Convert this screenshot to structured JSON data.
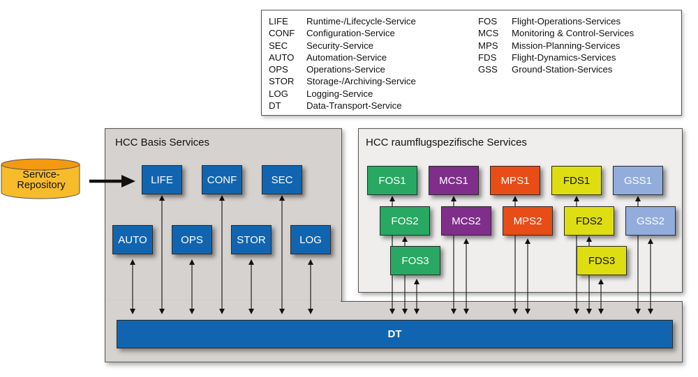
{
  "legend": {
    "left": [
      {
        "abbr": "LIFE",
        "name": "Runtime-/Lifecycle-Service"
      },
      {
        "abbr": "CONF",
        "name": "Configuration-Service"
      },
      {
        "abbr": "SEC",
        "name": "Security-Service"
      },
      {
        "abbr": "AUTO",
        "name": "Automation-Service"
      },
      {
        "abbr": "OPS",
        "name": "Operations-Service"
      },
      {
        "abbr": "STOR",
        "name": "Storage-/Archiving-Service"
      },
      {
        "abbr": "LOG",
        "name": "Logging-Service"
      },
      {
        "abbr": "DT",
        "name": "Data-Transport-Service"
      }
    ],
    "right": [
      {
        "abbr": "FOS",
        "name": "Flight-Operations-Services"
      },
      {
        "abbr": "MCS",
        "name": "Monitoring & Control-Services"
      },
      {
        "abbr": "MPS",
        "name": "Mission-Planning-Services"
      },
      {
        "abbr": "FDS",
        "name": "Flight-Dynamics-Services"
      },
      {
        "abbr": "GSS",
        "name": "Ground-Station-Services"
      }
    ]
  },
  "repository": {
    "label": "Service-\nRepository",
    "line1": "Service-",
    "line2": "Repository"
  },
  "basis_panel": {
    "title": "HCC Basis Services",
    "top_row": [
      "LIFE",
      "CONF",
      "SEC"
    ],
    "bottom_row": [
      "AUTO",
      "OPS",
      "STOR",
      "LOG"
    ],
    "bus": "DT"
  },
  "space_panel": {
    "title": "HCC raumflugspezifische Services",
    "groups": [
      {
        "family": "FOS",
        "color": "#28a862",
        "items": [
          "FOS1",
          "FOS2",
          "FOS3"
        ]
      },
      {
        "family": "MCS",
        "color": "#7f2e8a",
        "items": [
          "MCS1",
          "MCS2"
        ]
      },
      {
        "family": "MPS",
        "color": "#e84c17",
        "items": [
          "MPS1",
          "MPS2"
        ]
      },
      {
        "family": "FDS",
        "color": "#dedd12",
        "items": [
          "FDS1",
          "FDS2",
          "FDS3"
        ]
      },
      {
        "family": "GSS",
        "color": "#92acdc",
        "items": [
          "GSS1",
          "GSS2"
        ]
      }
    ]
  },
  "colors": {
    "basis_blue": "#1165b0",
    "basis_bg": "#d6d2cf",
    "space_bg": "#efeeed",
    "repo_yellow": "#f7bc2b"
  }
}
